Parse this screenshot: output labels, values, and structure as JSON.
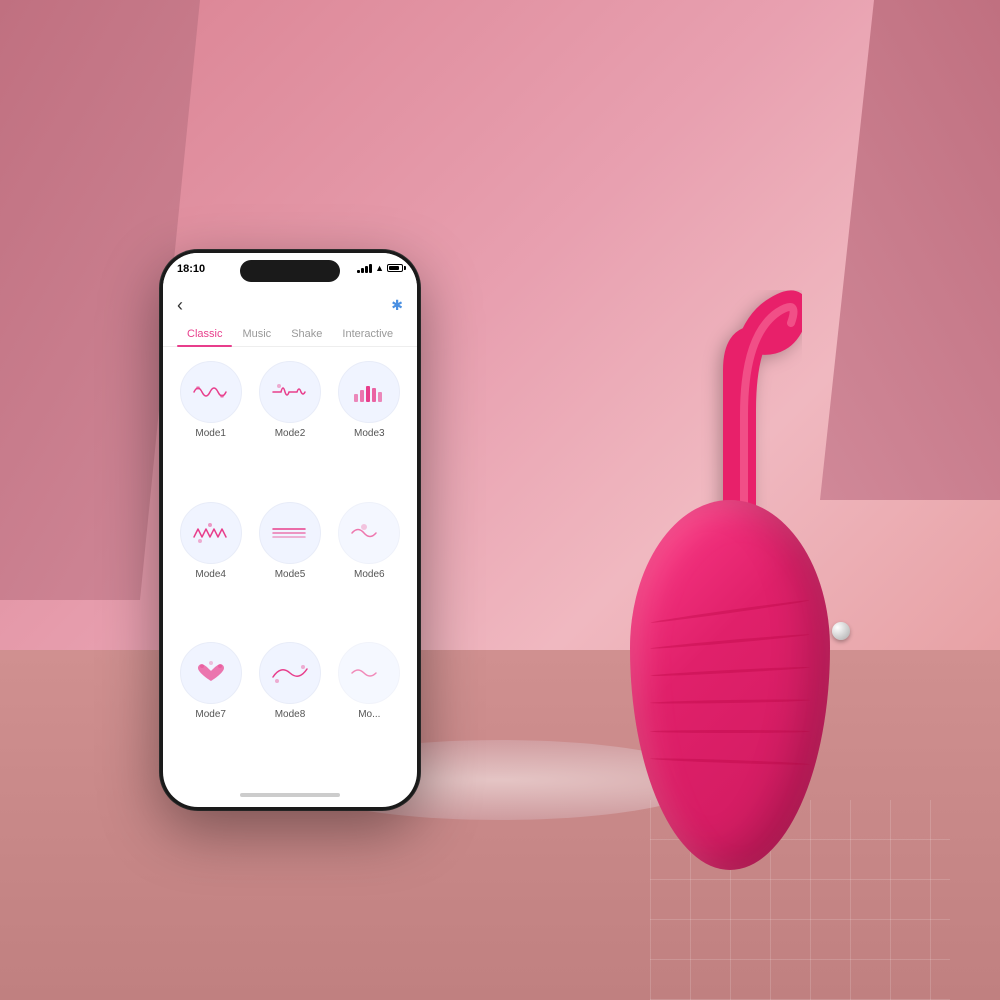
{
  "background": {
    "color": "#d9899a"
  },
  "phone": {
    "status": {
      "time": "18:10",
      "signal_bars": [
        3,
        5,
        7,
        9,
        11
      ],
      "has_wifi": true,
      "battery_percent": 80
    },
    "tabs": [
      {
        "id": "classic",
        "label": "Classic",
        "active": true
      },
      {
        "id": "music",
        "label": "Music",
        "active": false
      },
      {
        "id": "shake",
        "label": "Shake",
        "active": false
      },
      {
        "id": "interactive",
        "label": "Interactive",
        "active": false
      }
    ],
    "modes": [
      {
        "id": "mode1",
        "label": "Mode1",
        "pattern": "wave"
      },
      {
        "id": "mode2",
        "label": "Mode2",
        "pattern": "pulse"
      },
      {
        "id": "mode3",
        "label": "Mode3",
        "pattern": "bar"
      },
      {
        "id": "mode4",
        "label": "Mode4",
        "pattern": "zigzag"
      },
      {
        "id": "mode5",
        "label": "Mode5",
        "pattern": "stream"
      },
      {
        "id": "mode6",
        "label": "Mode6",
        "pattern": "partial"
      },
      {
        "id": "mode7",
        "label": "Mode7",
        "pattern": "heart"
      },
      {
        "id": "mode8",
        "label": "Mode8",
        "pattern": "curve"
      },
      {
        "id": "mode9",
        "label": "Mo...",
        "pattern": "partial2"
      }
    ],
    "back_label": "‹",
    "bluetooth_label": "⌁"
  },
  "device": {
    "color": "#e8206a",
    "accent": "#ff3d8a"
  }
}
